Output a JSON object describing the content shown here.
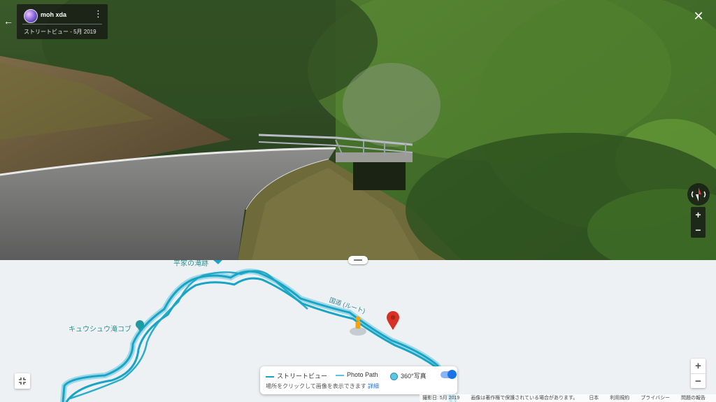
{
  "street_view": {
    "uploader": "moh xda",
    "subtitle": "ストリートビュー - 5月 2019",
    "back_icon": "arrow-left-icon",
    "close_icon": "close-icon",
    "zoom_in": "+",
    "zoom_out": "−"
  },
  "map": {
    "places": [
      {
        "label": "平家の滝跡",
        "icon": "pin-icon"
      },
      {
        "label": "キュウシュウ滝コブ",
        "icon": "pin-icon"
      },
      {
        "label": "国道 (ルート)",
        "icon": "road-label"
      }
    ],
    "zoom_in": "+",
    "zoom_out": "−",
    "legend": {
      "street_view_label": "ストリートビュー",
      "photo_path_label": "Photo Path",
      "photo360_label": "360°写真",
      "hint": "場所をクリックして画像を表示できます",
      "hint_link": "詳細"
    },
    "footer": {
      "date": "撮影日: 5月 2019",
      "copyright": "画像は著作権で保護されている場合があります。",
      "region": "日本",
      "terms": "利用規約",
      "privacy": "プライバシー",
      "report": "問題の報告"
    },
    "colors": {
      "route": "#18a5c5",
      "route_light": "#8fd3e6",
      "pin": "#d93025"
    }
  }
}
